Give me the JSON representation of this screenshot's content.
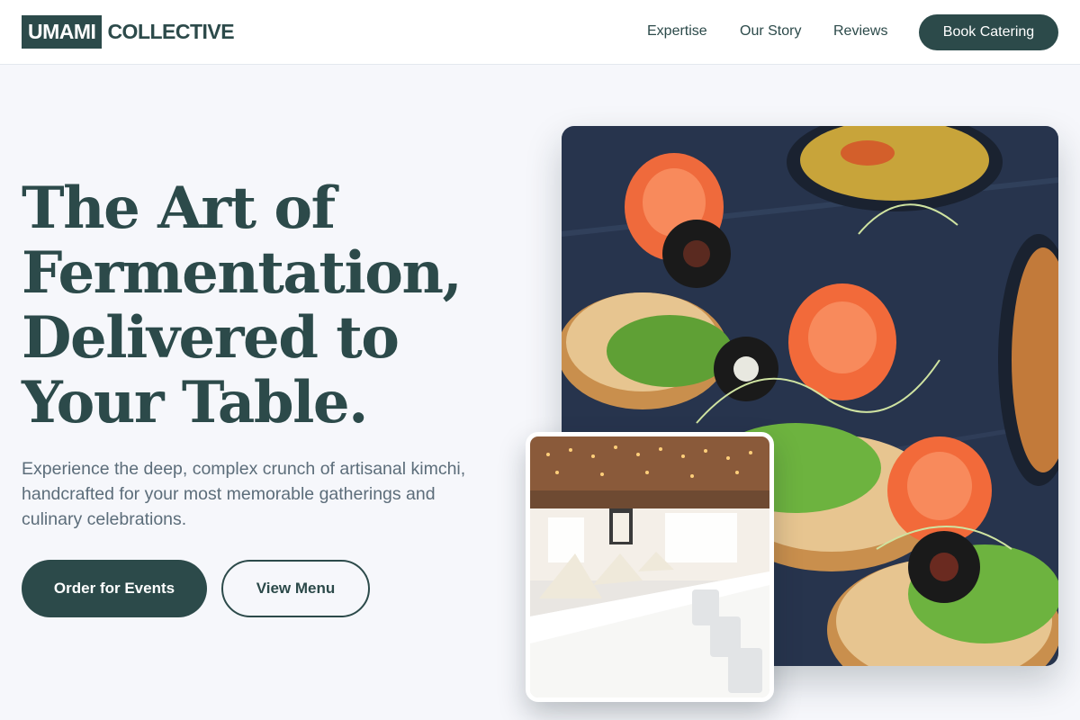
{
  "brand": {
    "box": "UMAMI",
    "text": "COLLECTIVE"
  },
  "nav": {
    "items": [
      "Expertise",
      "Our Story",
      "Reviews"
    ],
    "cta": "Book Catering"
  },
  "hero": {
    "title_lines": [
      "The Art of",
      "Fermentation,",
      "Delivered to",
      "Your Table."
    ],
    "subtitle": "Experience the deep, complex crunch of artisanal kimchi, handcrafted for your most memorable gatherings and culinary celebrations.",
    "primary_button": "Order for Events",
    "secondary_button": "View Menu"
  },
  "images": {
    "main": "salmon-canape-platter-photo",
    "secondary": "banquet-hall-table-photo"
  },
  "colors": {
    "brand": "#2c4a4a",
    "background": "#f6f7fb",
    "text_muted": "#5c6d7a"
  }
}
